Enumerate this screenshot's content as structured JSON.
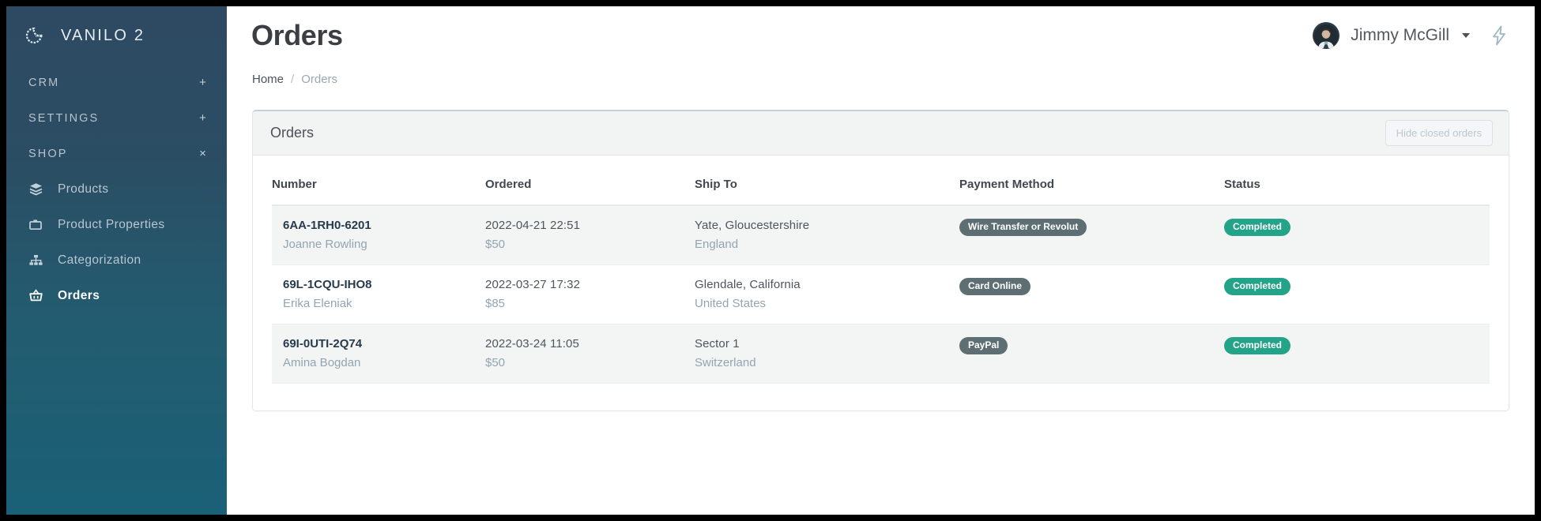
{
  "sidebar": {
    "brand": {
      "name": "VANILO 2",
      "logo_icon": "moon-logo-icon"
    },
    "groups": [
      {
        "label": "CRM",
        "sign": "+",
        "icon": "plus-icon"
      },
      {
        "label": "SETTINGS",
        "sign": "+",
        "icon": "plus-icon"
      },
      {
        "label": "SHOP",
        "sign": "×",
        "icon": "close-icon"
      }
    ],
    "items": [
      {
        "label": "Products",
        "icon": "layers-icon",
        "active": false
      },
      {
        "label": "Product Properties",
        "icon": "tag-folder-icon",
        "active": false
      },
      {
        "label": "Categorization",
        "icon": "sitemap-icon",
        "active": false
      },
      {
        "label": "Orders",
        "icon": "basket-icon",
        "active": true
      }
    ]
  },
  "header": {
    "title": "Orders",
    "user": {
      "name": "Jimmy McGill",
      "avatar_icon": "user-avatar",
      "caret_icon": "chevron-down-icon"
    },
    "bolt_icon": "lightning-bolt-icon"
  },
  "breadcrumb": {
    "home": "Home",
    "separator": "/",
    "current": "Orders"
  },
  "card": {
    "title": "Orders",
    "hide_closed_label": "Hide closed orders",
    "columns": [
      "Number",
      "Ordered",
      "Ship To",
      "Payment Method",
      "Status"
    ],
    "rows": [
      {
        "number": "6AA-1RH0-6201",
        "customer": "Joanne Rowling",
        "ordered_at": "2022-04-21 22:51",
        "amount": "$50",
        "ship_city": "Yate, Gloucestershire",
        "ship_country": "England",
        "payment_method": "Wire Transfer or Revolut",
        "status": "Completed"
      },
      {
        "number": "69L-1CQU-IHO8",
        "customer": "Erika Eleniak",
        "ordered_at": "2022-03-27 17:32",
        "amount": "$85",
        "ship_city": "Glendale, California",
        "ship_country": "United States",
        "payment_method": "Card Online",
        "status": "Completed"
      },
      {
        "number": "69I-0UTI-2Q74",
        "customer": "Amina Bogdan",
        "ordered_at": "2022-03-24 11:05",
        "amount": "$50",
        "ship_city": "Sector 1",
        "ship_country": "Switzerland",
        "payment_method": "PayPal",
        "status": "Completed"
      }
    ]
  },
  "colors": {
    "sidebar_top": "#2e4a63",
    "sidebar_bottom": "#1a6076",
    "badge_secondary": "#5e6f73",
    "badge_success": "#23a387",
    "link": "#273b4d"
  }
}
